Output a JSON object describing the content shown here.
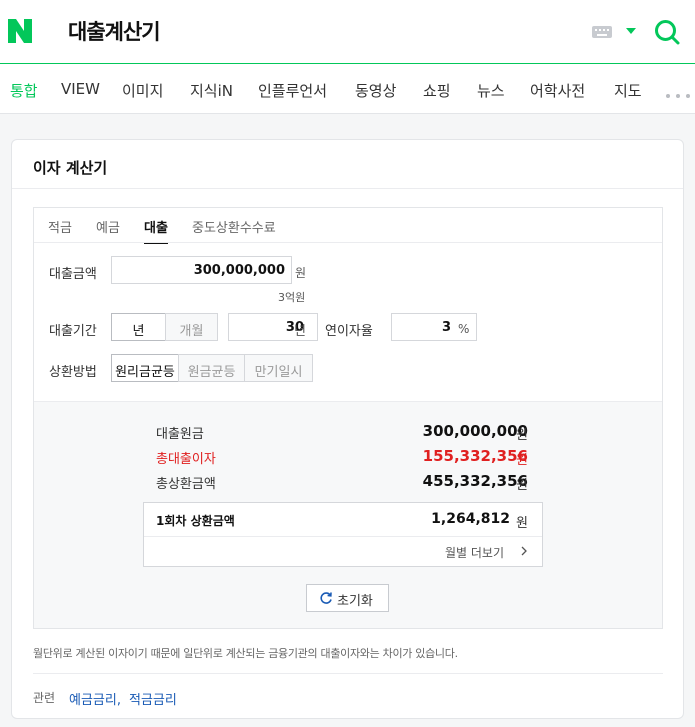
{
  "header": {
    "logo_text": "N",
    "query": "대출계산기"
  },
  "nav": {
    "items": [
      "통합",
      "VIEW",
      "이미지",
      "지식iN",
      "인플루언서",
      "동영상",
      "쇼핑",
      "뉴스",
      "어학사전",
      "지도"
    ],
    "active": "통합"
  },
  "card": {
    "title": "이자 계산기"
  },
  "tabs": [
    "적금",
    "예금",
    "대출",
    "중도상환수수료"
  ],
  "active_tab": "대출",
  "form": {
    "amount_label": "대출금액",
    "amount_value": "300,000,000",
    "amount_unit": "원",
    "amount_hint": "3억원",
    "period_label": "대출기간",
    "period_unit_year": "년",
    "period_unit_month": "개월",
    "period_value": "30",
    "period_value_unit": "년",
    "rate_label": "연이자율",
    "rate_value": "3",
    "rate_unit": "%",
    "method_label": "상환방법",
    "methods": [
      "원리금균등",
      "원금균등",
      "만기일시"
    ],
    "method_selected": "원리금균등"
  },
  "result": {
    "principal_label": "대출원금",
    "principal_value": "300,000,000",
    "interest_label": "총대출이자",
    "interest_value": "155,332,356",
    "total_label": "총상환금액",
    "total_value": "455,332,356",
    "unit": "원",
    "first_label": "1회차 상환금액",
    "first_value": "1,264,812",
    "monthly_more": "월별 더보기",
    "reset": "초기화"
  },
  "note": "월단위로 계산된 이자이기 때문에 일단위로 계산되는 금융기관의 대출이자와는 차이가 있습니다.",
  "related": {
    "label": "관련",
    "links": [
      "예금금리,",
      "적금금리"
    ]
  },
  "colors": {
    "brand": "#03c75a",
    "red": "#e02020",
    "link": "#1a5bb5"
  }
}
